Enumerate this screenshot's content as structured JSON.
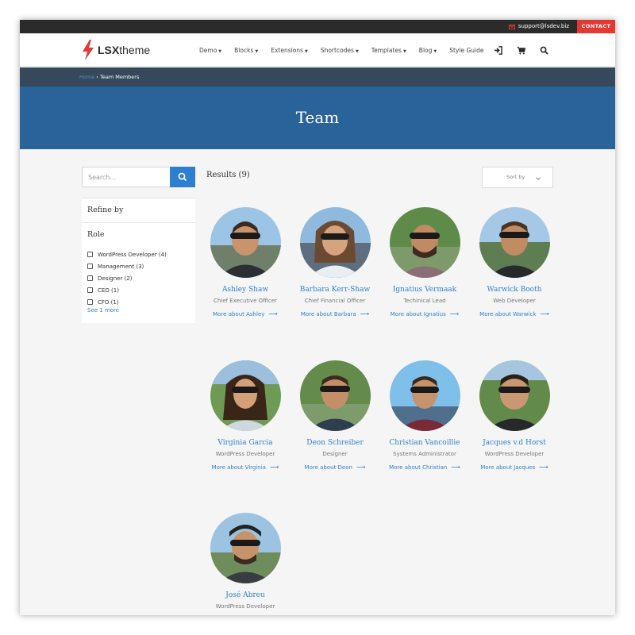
{
  "topbar": {
    "email": "support@lsdev.biz",
    "contact_label": "CONTACT"
  },
  "header": {
    "brand_bold": "LSX",
    "brand_rest": "theme",
    "nav": [
      {
        "label": "Demo"
      },
      {
        "label": "Blocks"
      },
      {
        "label": "Extensions"
      },
      {
        "label": "Shortcodes"
      },
      {
        "label": "Templates"
      },
      {
        "label": "Blog"
      },
      {
        "label": "Style Guide"
      }
    ],
    "icons": [
      "sign-in-icon",
      "cart-icon",
      "search-icon"
    ]
  },
  "breadcrumb": {
    "home": "Home",
    "separator": "›",
    "current": "Team Members"
  },
  "banner": {
    "title": "Team"
  },
  "search": {
    "placeholder": "Search..."
  },
  "sidebar": {
    "refine_title": "Refine by",
    "role_title": "Role",
    "filters": [
      {
        "label": "WordPress Developer (4)"
      },
      {
        "label": "Management (3)"
      },
      {
        "label": "Designer (2)"
      },
      {
        "label": "CEO (1)"
      },
      {
        "label": "CFO (1)"
      }
    ],
    "see_more": "See 1 more"
  },
  "results": {
    "label": "Results (9)",
    "sort_label": "Sort by"
  },
  "colors": {
    "accent": "#2f7fd0",
    "banner": "#2a629a",
    "breadcrumb_bar": "#35495a",
    "contact": "#e23a32"
  },
  "team": [
    {
      "name": "Ashley Shaw",
      "role": "Chief Executive Officer",
      "link": "More about Ashley"
    },
    {
      "name": "Barbara Kerr-Shaw",
      "role": "Chief Financial Officer",
      "link": "More about Barbara"
    },
    {
      "name": "Ignatius Vermaak",
      "role": "Techinical Lead",
      "link": "More about Ignatius"
    },
    {
      "name": "Warwick Booth",
      "role": "Web Developer",
      "link": "More about Warwick"
    },
    {
      "name": "Virginia Garcia",
      "role": "WordPress Developer",
      "link": "More about Virginia"
    },
    {
      "name": "Deon Schreiber",
      "role": "Designer",
      "link": "More about Deon"
    },
    {
      "name": "Christian Vancoillie",
      "role": "Systems Administrator",
      "link": "More about Christian"
    },
    {
      "name": "Jacques v.d Horst",
      "role": "WordPress Developer",
      "link": "More about Jacques"
    },
    {
      "name": "José Abreu",
      "role": "WordPress Developer"
    }
  ]
}
